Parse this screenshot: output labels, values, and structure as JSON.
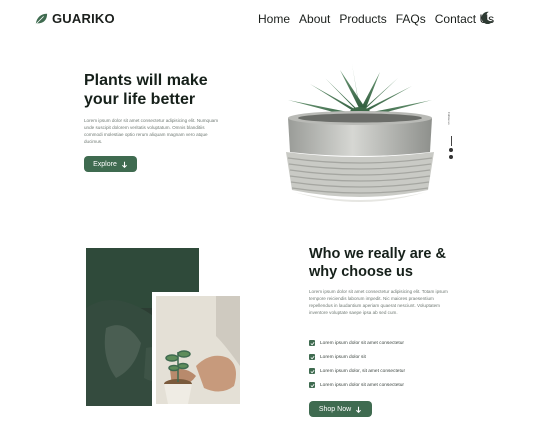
{
  "brand": {
    "name": "GUARIKO",
    "logo_icon": "leaf-icon"
  },
  "nav": {
    "items": [
      {
        "label": "Home"
      },
      {
        "label": "About"
      },
      {
        "label": "Products"
      },
      {
        "label": "FAQs"
      },
      {
        "label": "Contact Us"
      }
    ],
    "theme_toggle_icon": "moon-icon"
  },
  "hero": {
    "title": "Plants will make your life better",
    "description": "Lorem ipsum dolor sit amet consectetur adipisicing elit. Numquam unde suscipit dolorem veritatis voluptatum. Omnis blanditiis commodi molestiae optio rerum aliquam magnam vero atque ducimus.",
    "button_label": "Explore",
    "social_label": "Follow us"
  },
  "about": {
    "title": "Who we really are & why choose us",
    "description": "Lorem ipsum dolor sit amet consectetur adipisicing elit. Totam ipsum tempore reiciendis laborum impedit. Nic maiores praesentium repellendus in laudantium aperiam quaerat nesciunt. Voluptatem inventore voluptate saepe ipsa ab sed cum.",
    "checklist": [
      "Lorem ipsum dolor sit amet consectetur",
      "Lorem ipsum dolor sit",
      "Lorem ipsum dolor, sit amet consectetur",
      "Lorem ipsum dolor sit amet consectetur"
    ],
    "button_label": "Shop Now"
  },
  "colors": {
    "accent": "#3f6b50",
    "text": "#16201a",
    "muted": "#707a74"
  }
}
